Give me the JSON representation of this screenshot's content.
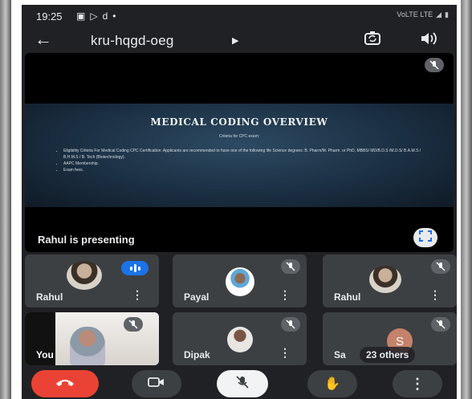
{
  "status_bar": {
    "time": "19:25",
    "indicators": [
      "message-icon",
      "cast-icon",
      "d",
      "dot"
    ],
    "network": "VoLTE LTE"
  },
  "header": {
    "meeting_code": "kru-hqgd-oeg",
    "back_icon": "arrow-back-icon",
    "switch_camera_icon": "switch-camera-icon",
    "speaker_icon": "speaker-icon"
  },
  "presentation": {
    "slide_title": "MEDICAL CODING OVERVIEW",
    "slide_subtitle": "Criteria for CPC exam:",
    "bullets": [
      "Eligibility Criteria For Medical Coding CPC Certification: Applicants are recommended to have one of the following life Science degrees: B. Pharm/M. Pharm. or PhD, MBBS/ MD/B.D.S /M.D.S/ B.A.M.S / B.H.M.S / B. Tech (Biotechnology).",
      "AAPC Membership.",
      "Exam fees."
    ],
    "presenter_text": "Rahul is presenting"
  },
  "participants": [
    {
      "name": "Rahul",
      "speaking": true
    },
    {
      "name": "Payal",
      "muted": true
    },
    {
      "name": "Rahul",
      "muted": true
    },
    {
      "name": "You",
      "muted": true
    },
    {
      "name": "Dipak",
      "muted": true
    },
    {
      "name": "Sa",
      "initial": "S",
      "others_label": "23 others",
      "muted": true
    }
  ],
  "colors": {
    "background": "#202124",
    "tile": "#3c4043",
    "end_call": "#ea4335",
    "speaking": "#1a73e8",
    "initial_avatar": "#c5826a"
  },
  "controls": {
    "end_call_icon": "phone-hangup-icon",
    "camera_icon": "camera-off-icon",
    "mic_icon": "mic-off-icon",
    "raise_hand_icon": "hand-icon",
    "more_icon": "more-vert-icon"
  }
}
